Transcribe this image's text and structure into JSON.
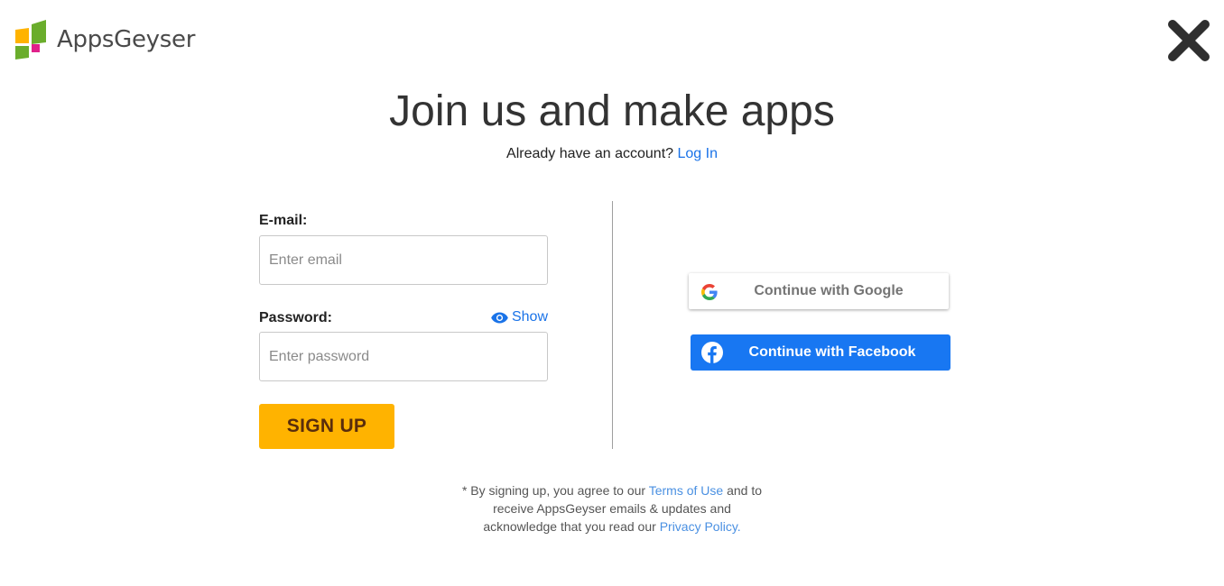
{
  "brand": {
    "name": "AppsGeyser",
    "logo_icon": "appsgeyser-logo-icon",
    "colors": {
      "orange": "#ffb300",
      "green": "#6aad2c",
      "pink": "#e0218a"
    }
  },
  "header": {
    "close_icon": "close-icon"
  },
  "main": {
    "title": "Join us and make apps",
    "login_prompt": "Already have an account?",
    "login_link": "Log In"
  },
  "form": {
    "email_label": "E-mail:",
    "email_placeholder": "Enter email",
    "email_value": "",
    "password_label": "Password:",
    "password_placeholder": "Enter password",
    "password_value": "",
    "show_label": "Show",
    "show_icon": "eye-icon",
    "signup_label": "SIGN UP"
  },
  "social": {
    "google_label": "Continue with Google",
    "google_icon": "google-icon",
    "facebook_label": "Continue with Facebook",
    "facebook_icon": "facebook-icon",
    "facebook_color": "#1877f2"
  },
  "disclaimer": {
    "part1": "* By signing up, you agree to our",
    "terms_link": "Terms of Use",
    "part2": "and to",
    "part3": "receive AppsGeyser emails & updates and",
    "part4": "acknowledge that you read our",
    "privacy_link": "Privacy Policy."
  },
  "accent_color": "#1a73e8"
}
